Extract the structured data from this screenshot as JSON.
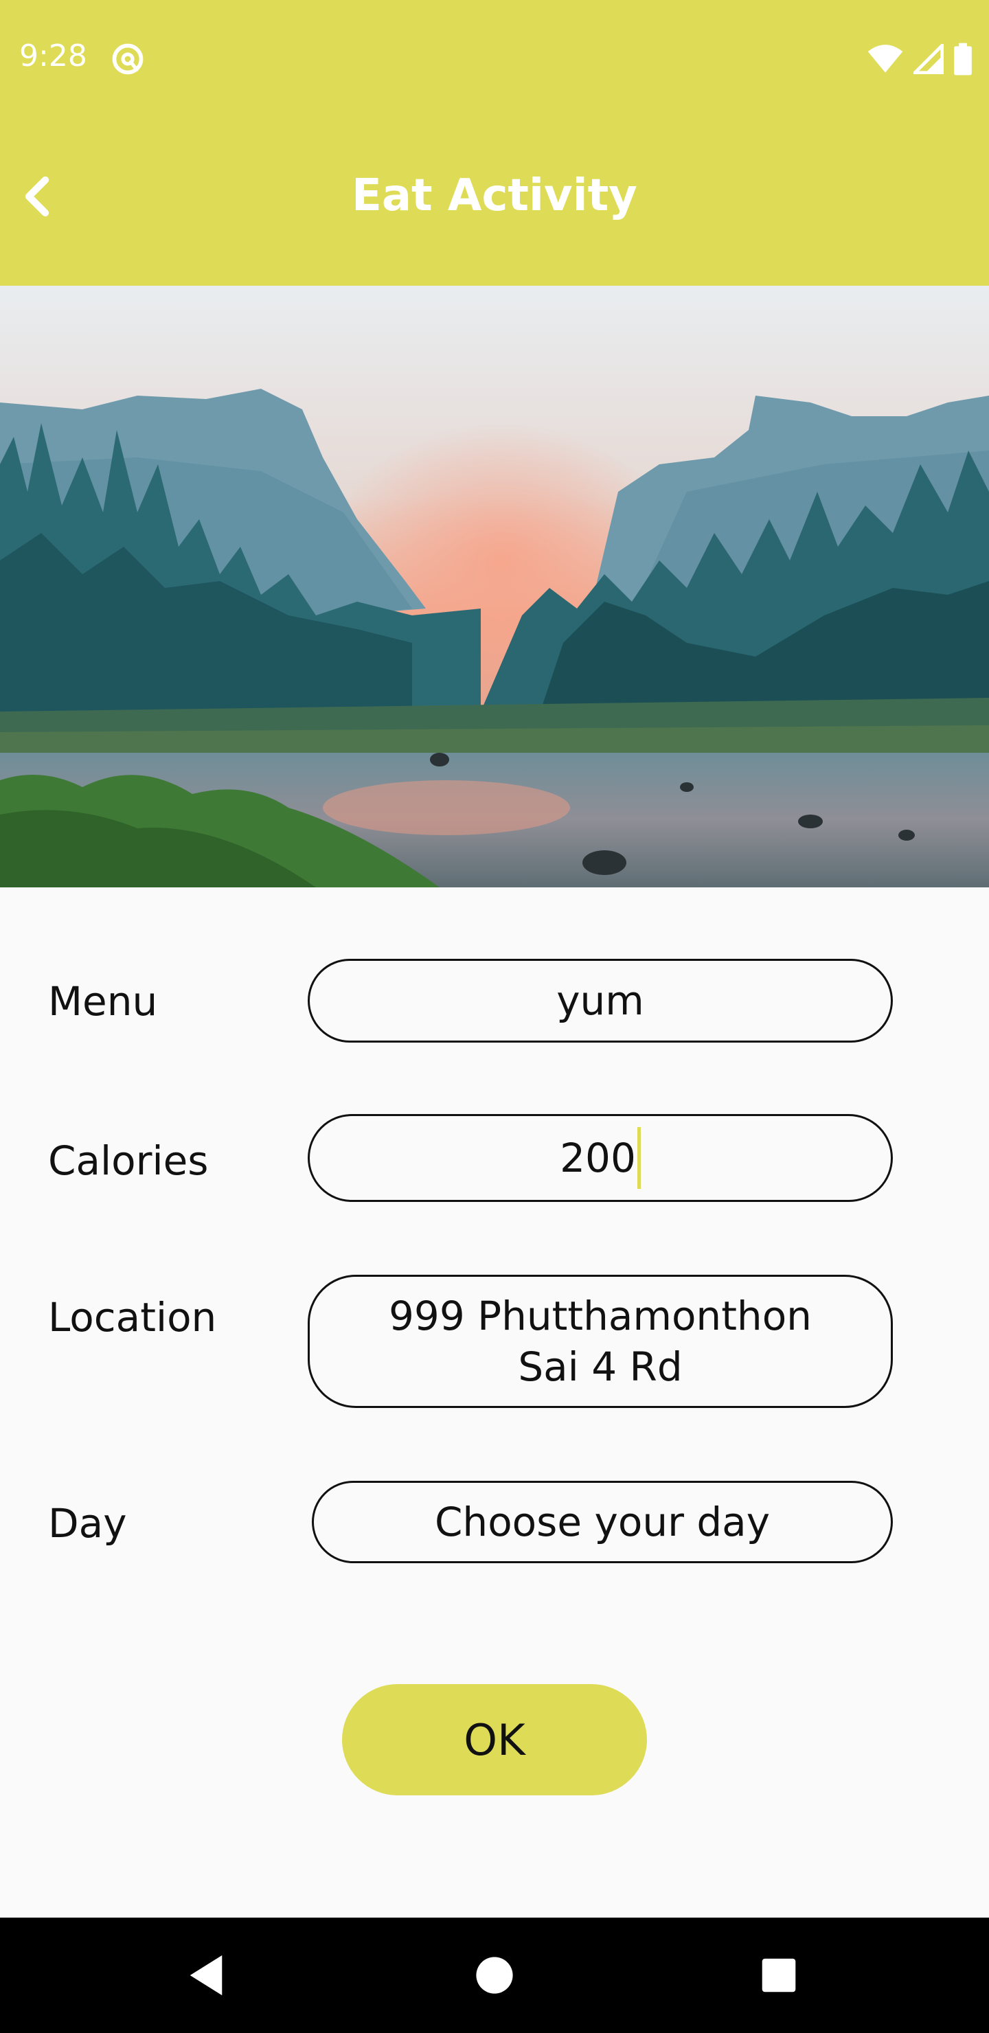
{
  "status_bar": {
    "time": "9:28",
    "color": "#dedc56",
    "icons": [
      "at-sign-icon",
      "wifi-icon",
      "signal-icon",
      "battery-icon"
    ]
  },
  "app_bar": {
    "title": "Eat Activity",
    "back_icon": "chevron-left-icon"
  },
  "hero": {
    "description_icon": "landscape-image"
  },
  "form": {
    "menu": {
      "label": "Menu",
      "value": "yum"
    },
    "calories": {
      "label": "Calories",
      "value": "200"
    },
    "location": {
      "label": "Location",
      "value_line1": "999 Phutthamonthon",
      "value_line2": "Sai 4 Rd"
    },
    "day": {
      "label": "Day",
      "placeholder": "Choose your day"
    }
  },
  "ok_button": {
    "label": "OK"
  },
  "nav_bar": {
    "icons": [
      "back-triangle-icon",
      "home-circle-icon",
      "recents-square-icon"
    ]
  },
  "colors": {
    "accent": "#dedc56",
    "background": "#fafafa",
    "text": "#111111"
  }
}
